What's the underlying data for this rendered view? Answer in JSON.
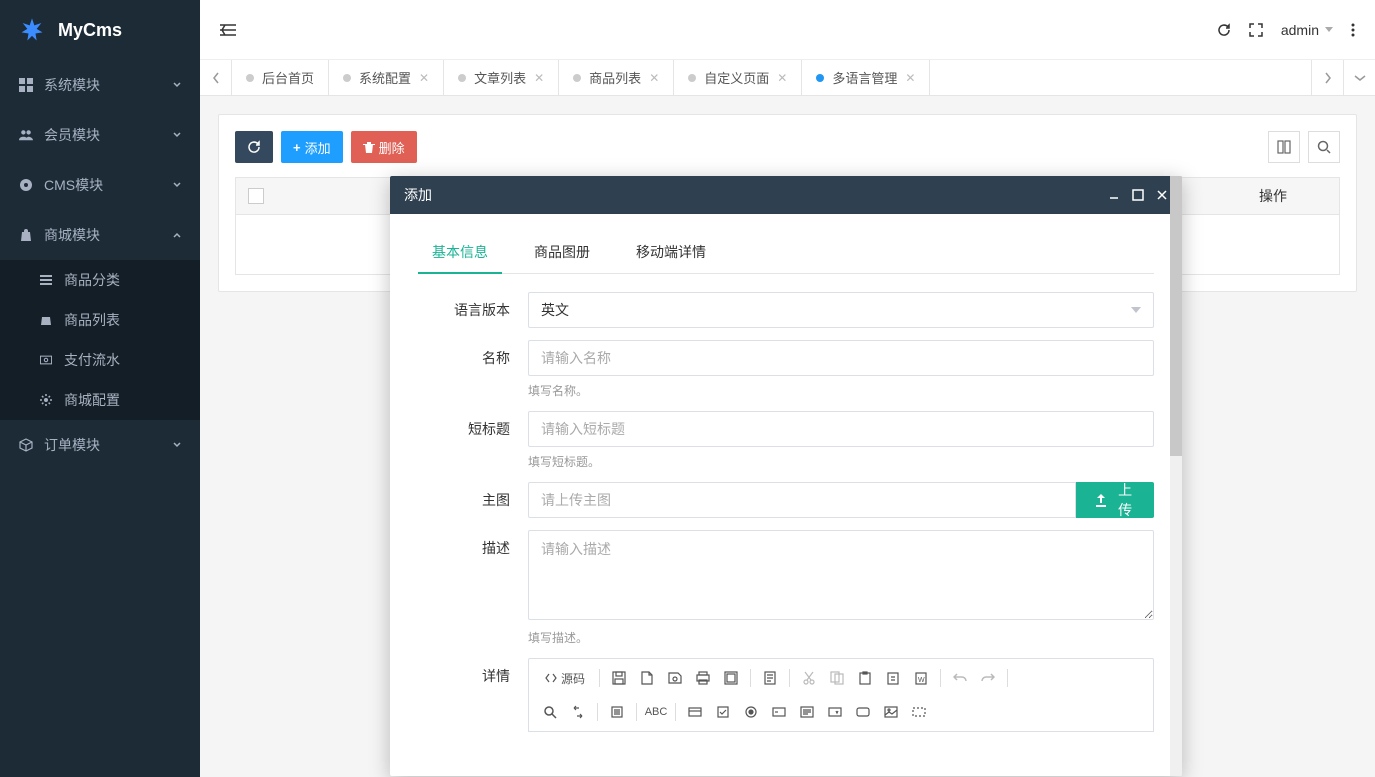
{
  "brand": {
    "name": "MyCms"
  },
  "sidebar": {
    "items": [
      {
        "label": "系统模块"
      },
      {
        "label": "会员模块"
      },
      {
        "label": "CMS模块"
      },
      {
        "label": "商城模块",
        "children": [
          {
            "label": "商品分类"
          },
          {
            "label": "商品列表"
          },
          {
            "label": "支付流水"
          },
          {
            "label": "商城配置"
          }
        ]
      },
      {
        "label": "订单模块"
      }
    ]
  },
  "topbar": {
    "user": "admin"
  },
  "tabs": [
    {
      "label": "后台首页",
      "closable": false
    },
    {
      "label": "系统配置",
      "closable": true
    },
    {
      "label": "文章列表",
      "closable": true
    },
    {
      "label": "商品列表",
      "closable": true
    },
    {
      "label": "自定义页面",
      "closable": true
    },
    {
      "label": "多语言管理",
      "closable": true,
      "active": true
    }
  ],
  "toolbar": {
    "add_label": "添加",
    "delete_label": "删除"
  },
  "table": {
    "op_header": "操作"
  },
  "modal": {
    "title": "添加",
    "tabs": [
      {
        "label": "基本信息",
        "active": true
      },
      {
        "label": "商品图册"
      },
      {
        "label": "移动端详情"
      }
    ],
    "fields": {
      "language": {
        "label": "语言版本",
        "value": "英文"
      },
      "name": {
        "label": "名称",
        "placeholder": "请输入名称",
        "hint": "填写名称。"
      },
      "short_title": {
        "label": "短标题",
        "placeholder": "请输入短标题",
        "hint": "填写短标题。"
      },
      "main_image": {
        "label": "主图",
        "placeholder": "请上传主图",
        "upload": "上传"
      },
      "description": {
        "label": "描述",
        "placeholder": "请输入描述",
        "hint": "填写描述。"
      },
      "detail": {
        "label": "详情",
        "source_label": "源码"
      }
    }
  }
}
